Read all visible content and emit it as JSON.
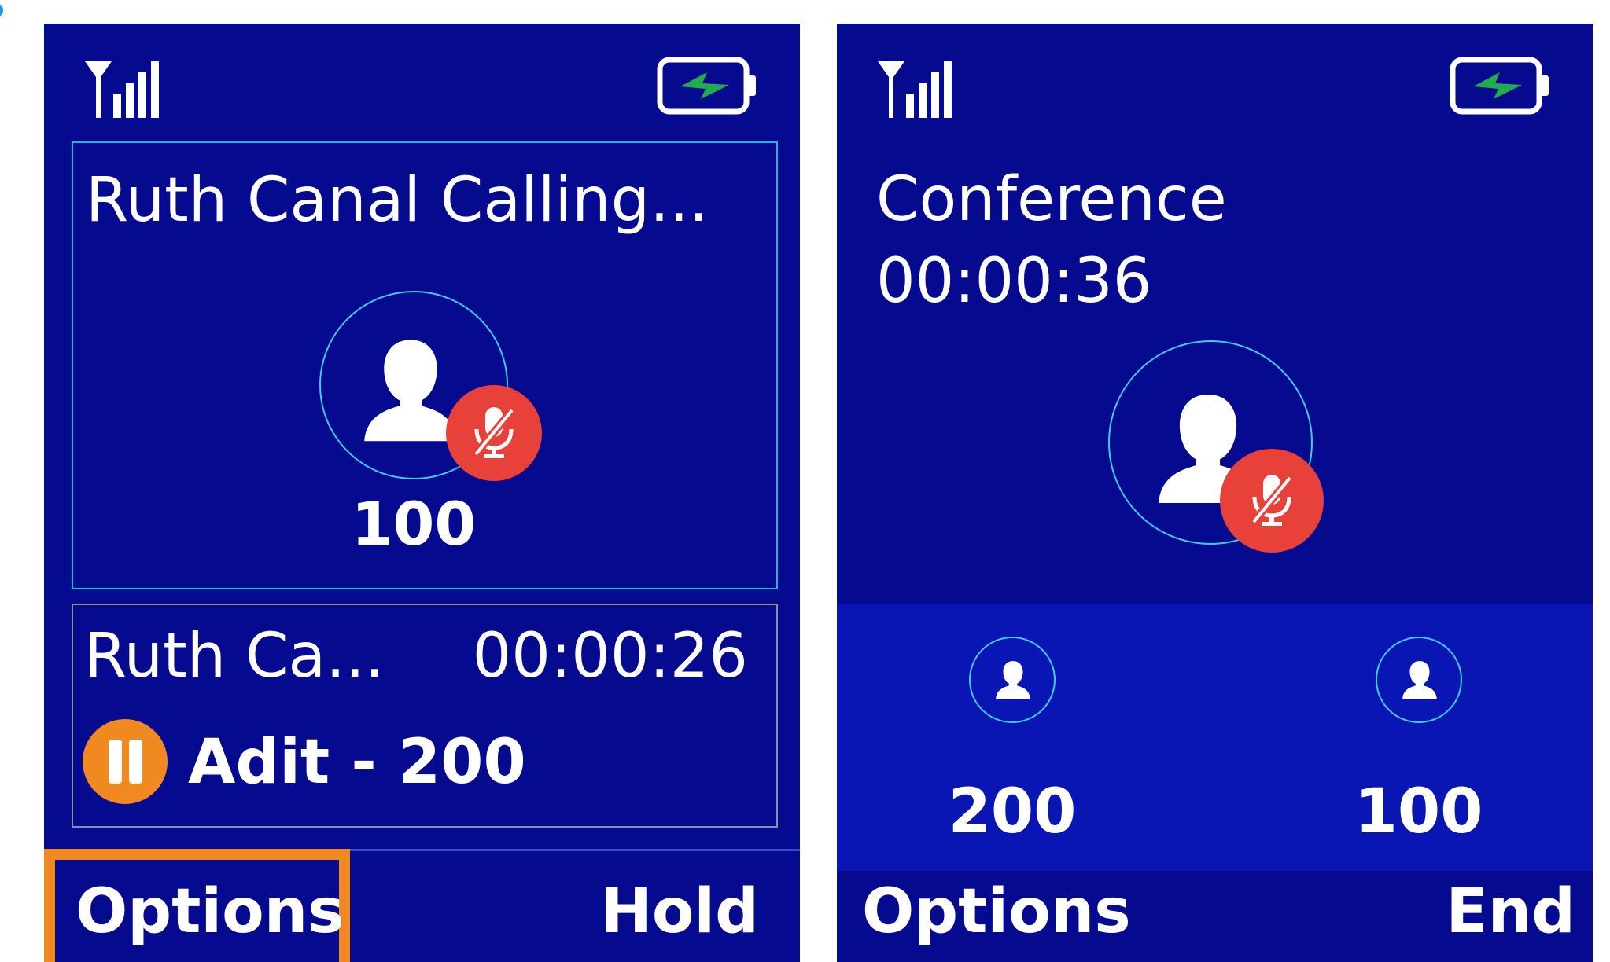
{
  "left_screen": {
    "active_call": {
      "title": "Ruth Canal Calling...",
      "number": "100",
      "avatar_icon": "person-icon",
      "badge_icon": "microphone-muted-icon"
    },
    "held_call": {
      "name": "Ruth Ca...",
      "timer": "00:00:26",
      "status_icon": "pause-icon",
      "party": "Adit - 200"
    },
    "softkeys": {
      "left": "Options",
      "right": "Hold"
    }
  },
  "right_screen": {
    "title": "Conference",
    "timer": "00:00:36",
    "avatar_icon": "person-icon",
    "badge_icon": "microphone-muted-icon",
    "participants": [
      {
        "number": "200",
        "icon": "person-icon"
      },
      {
        "number": "100",
        "icon": "person-icon"
      }
    ],
    "softkeys": {
      "left": "Options",
      "right": "End"
    }
  },
  "status_bar": {
    "signal_icon": "signal-strength-icon",
    "battery_icon": "battery-charging-icon"
  },
  "colors": {
    "screen_bg": "#060a8e",
    "participants_bg": "#0a16b4",
    "focus_orange": "#f0891f",
    "mute_red": "#e8413a",
    "avatar_ring": "#3ccce6",
    "battery_bolt": "#1fae4b"
  }
}
